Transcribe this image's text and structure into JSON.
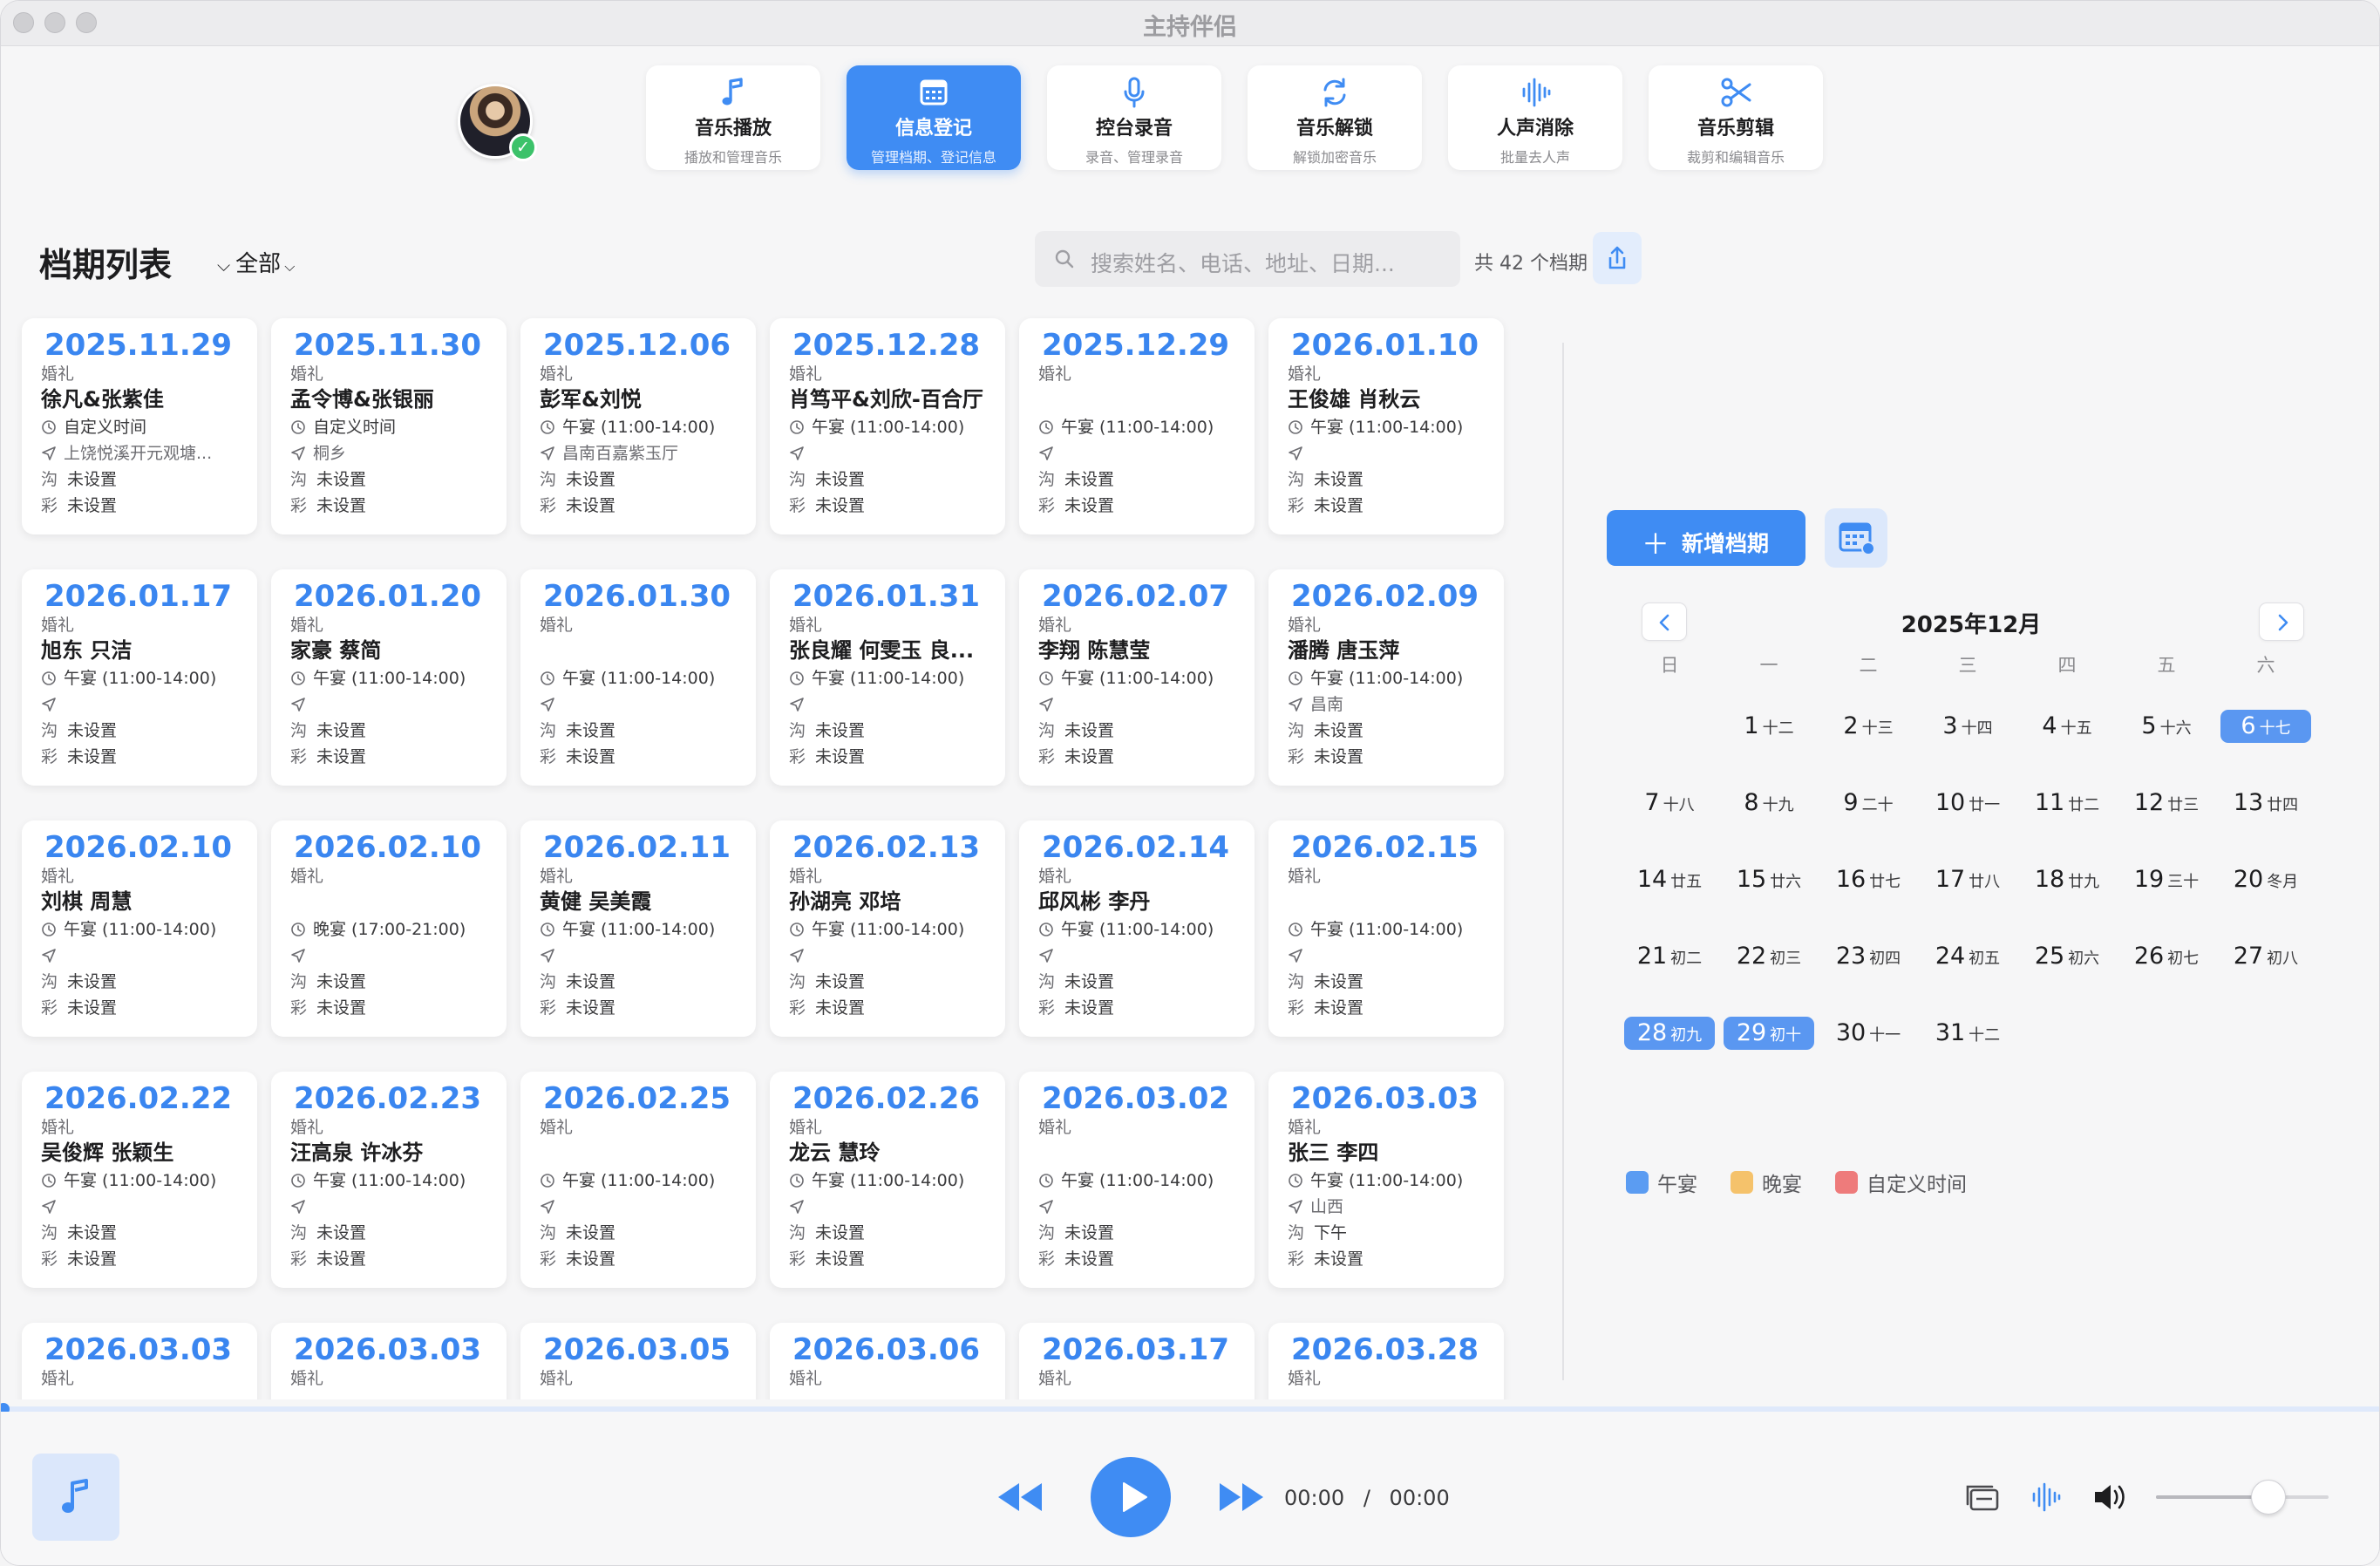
{
  "window": {
    "title": "主持伴侣"
  },
  "nav": [
    {
      "label": "音乐播放",
      "sub": "播放和管理音乐",
      "icon": "music-note-icon",
      "active": false
    },
    {
      "label": "信息登记",
      "sub": "管理档期、登记信息",
      "icon": "calendar-grid-icon",
      "active": true
    },
    {
      "label": "控台录音",
      "sub": "录音、管理录音",
      "icon": "microphone-icon",
      "active": false
    },
    {
      "label": "音乐解锁",
      "sub": "解锁加密音乐",
      "icon": "refresh-cycle-icon",
      "active": false
    },
    {
      "label": "人声消除",
      "sub": "批量去人声",
      "icon": "waveform-icon",
      "active": false
    },
    {
      "label": "音乐剪辑",
      "sub": "裁剪和编辑音乐",
      "icon": "scissors-icon",
      "active": false
    }
  ],
  "header": {
    "title": "档期列表",
    "filter": "全部",
    "search_placeholder": "搜索姓名、电话、地址、日期...",
    "count": "共 42 个档期"
  },
  "card_labels": {
    "comm": "沟",
    "cai": "彩"
  },
  "cards": [
    {
      "date": "2025.11.29",
      "type": "婚礼",
      "names": "徐凡&张紫佳",
      "time": "自定义时间",
      "location": "上饶悦溪开元观塘...",
      "comm": "未设置",
      "cai": "未设置"
    },
    {
      "date": "2025.11.30",
      "type": "婚礼",
      "names": "孟令博&张银丽",
      "time": "自定义时间",
      "location": "桐乡",
      "comm": "未设置",
      "cai": "未设置"
    },
    {
      "date": "2025.12.06",
      "type": "婚礼",
      "names": "彭军&刘悦",
      "time": "午宴 (11:00-14:00)",
      "location": "昌南百嘉紫玉厅",
      "comm": "未设置",
      "cai": "未设置"
    },
    {
      "date": "2025.12.28",
      "type": "婚礼",
      "names": "肖笃平&刘欣-百合厅",
      "time": "午宴 (11:00-14:00)",
      "location": "",
      "comm": "未设置",
      "cai": "未设置"
    },
    {
      "date": "2025.12.29",
      "type": "婚礼",
      "names": "",
      "time": "午宴 (11:00-14:00)",
      "location": "",
      "comm": "未设置",
      "cai": "未设置"
    },
    {
      "date": "2026.01.10",
      "type": "婚礼",
      "names": "王俊雄 肖秋云",
      "time": "午宴 (11:00-14:00)",
      "location": "",
      "comm": "未设置",
      "cai": "未设置"
    },
    {
      "date": "2026.01.17",
      "type": "婚礼",
      "names": "旭东 只洁",
      "time": "午宴 (11:00-14:00)",
      "location": "",
      "comm": "未设置",
      "cai": "未设置"
    },
    {
      "date": "2026.01.20",
      "type": "婚礼",
      "names": "家豪 蔡简",
      "time": "午宴 (11:00-14:00)",
      "location": "",
      "comm": "未设置",
      "cai": "未设置"
    },
    {
      "date": "2026.01.30",
      "type": "婚礼",
      "names": "",
      "time": "午宴 (11:00-14:00)",
      "location": "",
      "comm": "未设置",
      "cai": "未设置"
    },
    {
      "date": "2026.01.31",
      "type": "婚礼",
      "names": "张良耀 何雯玉 良...",
      "time": "午宴 (11:00-14:00)",
      "location": "",
      "comm": "未设置",
      "cai": "未设置"
    },
    {
      "date": "2026.02.07",
      "type": "婚礼",
      "names": "李翔 陈慧莹",
      "time": "午宴 (11:00-14:00)",
      "location": "",
      "comm": "未设置",
      "cai": "未设置"
    },
    {
      "date": "2026.02.09",
      "type": "婚礼",
      "names": "潘腾 唐玉萍",
      "time": "午宴 (11:00-14:00)",
      "location": "昌南",
      "comm": "未设置",
      "cai": "未设置"
    },
    {
      "date": "2026.02.10",
      "type": "婚礼",
      "names": "刘棋 周慧",
      "time": "午宴 (11:00-14:00)",
      "location": "",
      "comm": "未设置",
      "cai": "未设置"
    },
    {
      "date": "2026.02.10",
      "type": "婚礼",
      "names": "",
      "time": "晚宴 (17:00-21:00)",
      "location": "",
      "comm": "未设置",
      "cai": "未设置"
    },
    {
      "date": "2026.02.11",
      "type": "婚礼",
      "names": "黄健 吴美霞",
      "time": "午宴 (11:00-14:00)",
      "location": "",
      "comm": "未设置",
      "cai": "未设置"
    },
    {
      "date": "2026.02.13",
      "type": "婚礼",
      "names": "孙湖亮 邓培",
      "time": "午宴 (11:00-14:00)",
      "location": "",
      "comm": "未设置",
      "cai": "未设置"
    },
    {
      "date": "2026.02.14",
      "type": "婚礼",
      "names": "邱风彬 李丹",
      "time": "午宴 (11:00-14:00)",
      "location": "",
      "comm": "未设置",
      "cai": "未设置"
    },
    {
      "date": "2026.02.15",
      "type": "婚礼",
      "names": "",
      "time": "午宴 (11:00-14:00)",
      "location": "",
      "comm": "未设置",
      "cai": "未设置"
    },
    {
      "date": "2026.02.22",
      "type": "婚礼",
      "names": "吴俊辉 张颖生",
      "time": "午宴 (11:00-14:00)",
      "location": "",
      "comm": "未设置",
      "cai": "未设置"
    },
    {
      "date": "2026.02.23",
      "type": "婚礼",
      "names": "汪高泉 许冰芬",
      "time": "午宴 (11:00-14:00)",
      "location": "",
      "comm": "未设置",
      "cai": "未设置"
    },
    {
      "date": "2026.02.25",
      "type": "婚礼",
      "names": "",
      "time": "午宴 (11:00-14:00)",
      "location": "",
      "comm": "未设置",
      "cai": "未设置"
    },
    {
      "date": "2026.02.26",
      "type": "婚礼",
      "names": "龙云 慧玲",
      "time": "午宴 (11:00-14:00)",
      "location": "",
      "comm": "未设置",
      "cai": "未设置"
    },
    {
      "date": "2026.03.02",
      "type": "婚礼",
      "names": "",
      "time": "午宴 (11:00-14:00)",
      "location": "",
      "comm": "未设置",
      "cai": "未设置"
    },
    {
      "date": "2026.03.03",
      "type": "婚礼",
      "names": "张三 李四",
      "time": "午宴 (11:00-14:00)",
      "location": "山西",
      "comm": "下午",
      "cai": "未设置"
    },
    {
      "date": "2026.03.03",
      "type": "婚礼",
      "names": "",
      "time": "",
      "location": "",
      "comm": "",
      "cai": ""
    },
    {
      "date": "2026.03.03",
      "type": "婚礼",
      "names": "",
      "time": "",
      "location": "",
      "comm": "",
      "cai": ""
    },
    {
      "date": "2026.03.05",
      "type": "婚礼",
      "names": "",
      "time": "",
      "location": "",
      "comm": "",
      "cai": ""
    },
    {
      "date": "2026.03.06",
      "type": "婚礼",
      "names": "",
      "time": "",
      "location": "",
      "comm": "",
      "cai": ""
    },
    {
      "date": "2026.03.17",
      "type": "婚礼",
      "names": "",
      "time": "",
      "location": "",
      "comm": "",
      "cai": ""
    },
    {
      "date": "2026.03.28",
      "type": "婚礼",
      "names": "",
      "time": "",
      "location": "",
      "comm": "",
      "cai": ""
    }
  ],
  "sidebar": {
    "add_button": "新增档期",
    "calendar": {
      "title": "2025年12月",
      "weekdays": [
        "日",
        "一",
        "二",
        "三",
        "四",
        "五",
        "六"
      ],
      "days": [
        {
          "n": "1",
          "l": "十二"
        },
        {
          "n": "2",
          "l": "十三"
        },
        {
          "n": "3",
          "l": "十四"
        },
        {
          "n": "4",
          "l": "十五"
        },
        {
          "n": "5",
          "l": "十六"
        },
        {
          "n": "6",
          "l": "十七",
          "selected": true
        },
        {
          "n": "7",
          "l": "十八"
        },
        {
          "n": "8",
          "l": "十九"
        },
        {
          "n": "9",
          "l": "二十"
        },
        {
          "n": "10",
          "l": "廿一"
        },
        {
          "n": "11",
          "l": "廿二"
        },
        {
          "n": "12",
          "l": "廿三"
        },
        {
          "n": "13",
          "l": "廿四"
        },
        {
          "n": "14",
          "l": "廿五"
        },
        {
          "n": "15",
          "l": "廿六"
        },
        {
          "n": "16",
          "l": "廿七"
        },
        {
          "n": "17",
          "l": "廿八"
        },
        {
          "n": "18",
          "l": "廿九"
        },
        {
          "n": "19",
          "l": "三十"
        },
        {
          "n": "20",
          "l": "冬月"
        },
        {
          "n": "21",
          "l": "初二"
        },
        {
          "n": "22",
          "l": "初三"
        },
        {
          "n": "23",
          "l": "初四"
        },
        {
          "n": "24",
          "l": "初五"
        },
        {
          "n": "25",
          "l": "初六"
        },
        {
          "n": "26",
          "l": "初七"
        },
        {
          "n": "27",
          "l": "初八"
        },
        {
          "n": "28",
          "l": "初九",
          "selected": true
        },
        {
          "n": "29",
          "l": "初十",
          "selected": true
        },
        {
          "n": "30",
          "l": "十一"
        },
        {
          "n": "31",
          "l": "十二"
        }
      ]
    },
    "legend": [
      {
        "label": "午宴",
        "color": "#5b9cf2"
      },
      {
        "label": "晚宴",
        "color": "#f5c26b"
      },
      {
        "label": "自定义时间",
        "color": "#ee7b7b"
      }
    ]
  },
  "player": {
    "current_time": "00:00",
    "separator": "/",
    "total_time": "00:00",
    "progress": 0,
    "volume": 0.65
  },
  "colors": {
    "accent": "#3f8cf3",
    "date_text": "#3a86f0"
  }
}
